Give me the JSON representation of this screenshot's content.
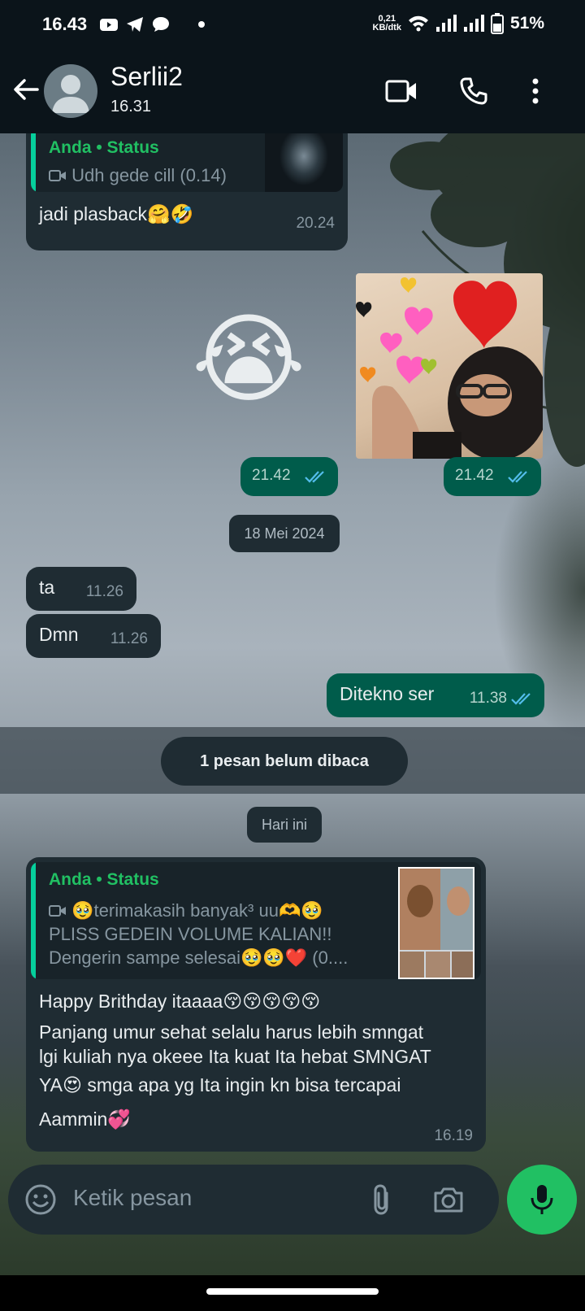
{
  "status_bar": {
    "time": "16.43",
    "speed_value": "0,21",
    "speed_unit": "KB/dtk",
    "battery": "51%"
  },
  "header": {
    "contact_name": "Serlii2",
    "last_seen": "16.31"
  },
  "messages": {
    "m1": {
      "quote_title": "Anda • Status",
      "quote_text": "Udh gede cill (0.14)",
      "text": "jadi plasback🤗🤣",
      "time": "20.24"
    },
    "sticker_time": "21.42",
    "image_time": "21.42",
    "date_divider": "18 Mei 2024",
    "m2": {
      "text": "ta",
      "time": "11.26"
    },
    "m3": {
      "text": "Dmn",
      "time": "11.26"
    },
    "m4": {
      "text": "Ditekno ser",
      "time": "11.38"
    },
    "unread": "1 pesan belum dibaca",
    "today_divider": "Hari ini",
    "m5": {
      "quote_title": "Anda • Status",
      "quote_line1": "🥹terimakasih banyak³ uu🫶🥹",
      "quote_line2": "PLISS GEDEIN VOLUME KALIAN!!",
      "quote_line3": "Dengerin sampe selesai🥹🥹❤️ (0....",
      "line1": "Happy Brithday itaaaa😚😚😚😚😚",
      "line2": "Panjang umur sehat selalu harus lebih  smngat",
      "line3": "lgi kuliah nya okeee Ita kuat Ita hebat SMNGAT",
      "line4": "YA😍 smga apa yg Ita ingin kn bisa tercapai",
      "line5": "Aammin💞",
      "time": "16.19"
    }
  },
  "sticker_emoji": "😭",
  "input": {
    "placeholder": "Ketik pesan"
  }
}
